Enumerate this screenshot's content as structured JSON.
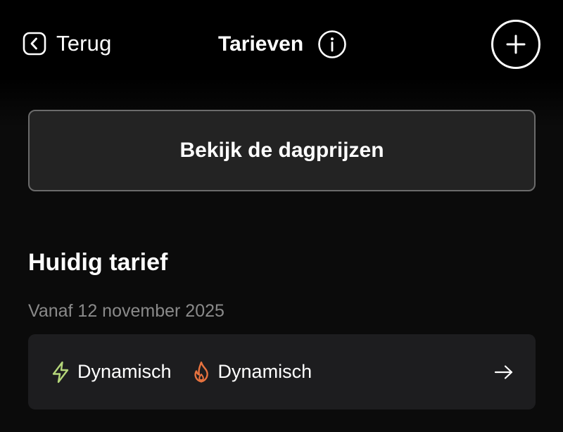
{
  "header": {
    "back_label": "Terug",
    "title": "Tarieven",
    "info_icon": "info-icon",
    "add_icon": "plus-icon"
  },
  "day_prices": {
    "label": "Bekijk de dagprijzen"
  },
  "current_tariff": {
    "heading": "Huidig tarief",
    "since": "Vanaf 12 november 2025",
    "electricity": {
      "icon": "lightning-icon",
      "label": "Dynamisch",
      "color": "#b5d67a"
    },
    "gas": {
      "icon": "flame-icon",
      "label": "Dynamisch",
      "color": "#e8733f"
    }
  },
  "colors": {
    "background": "#000000",
    "card": "#1d1d1f",
    "button": "#232323",
    "muted_text": "#8a8a8a"
  }
}
